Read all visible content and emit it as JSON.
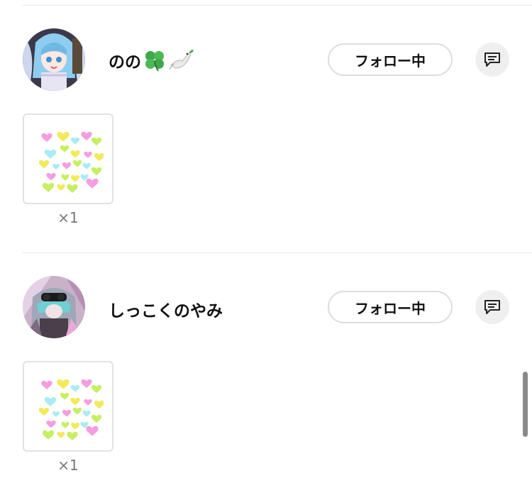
{
  "entries": [
    {
      "username": "のの",
      "emojis": [
        "clover-icon",
        "dove-icon"
      ],
      "follow_label": "フォロー中",
      "gift_count": "×1"
    },
    {
      "username": "しっこくのやみ",
      "emojis": [],
      "follow_label": "フォロー中",
      "gift_count": "×1"
    }
  ],
  "colors": {
    "heart_pink": "#f59de0",
    "heart_yellow": "#f2ea5a",
    "heart_cyan": "#a8ecf5",
    "heart_green": "#c7ef62",
    "button_border": "#dddddd",
    "message_button_bg": "#efefef"
  }
}
